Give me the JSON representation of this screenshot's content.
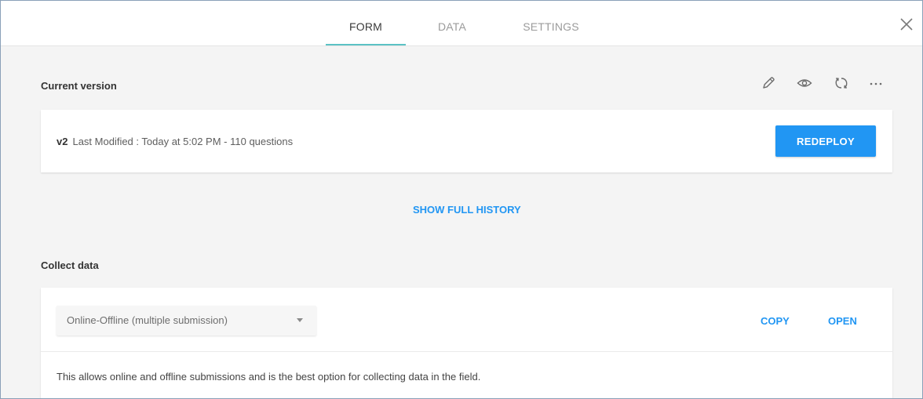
{
  "tabs": [
    {
      "label": "FORM",
      "active": true
    },
    {
      "label": "DATA",
      "active": false
    },
    {
      "label": "SETTINGS",
      "active": false
    }
  ],
  "close_icon": "close-icon",
  "current_version": {
    "title": "Current version",
    "actions": [
      "edit-pencil-icon",
      "preview-eye-icon",
      "refresh-icon",
      "more-icon"
    ],
    "version_label": "v2",
    "details": "Last Modified : Today at 5:02 PM - 110 questions",
    "redeploy_label": "REDEPLOY"
  },
  "history_link": "SHOW FULL HISTORY",
  "collect": {
    "title": "Collect data",
    "selected_option": "Online-Offline (multiple submission)",
    "copy_label": "COPY",
    "open_label": "OPEN",
    "description": "This allows online and offline submissions and is the best option for collecting data in the field."
  },
  "colors": {
    "accent_blue": "#2196f3",
    "tab_underline": "#5cc2c5",
    "background": "#f4f4f4"
  }
}
